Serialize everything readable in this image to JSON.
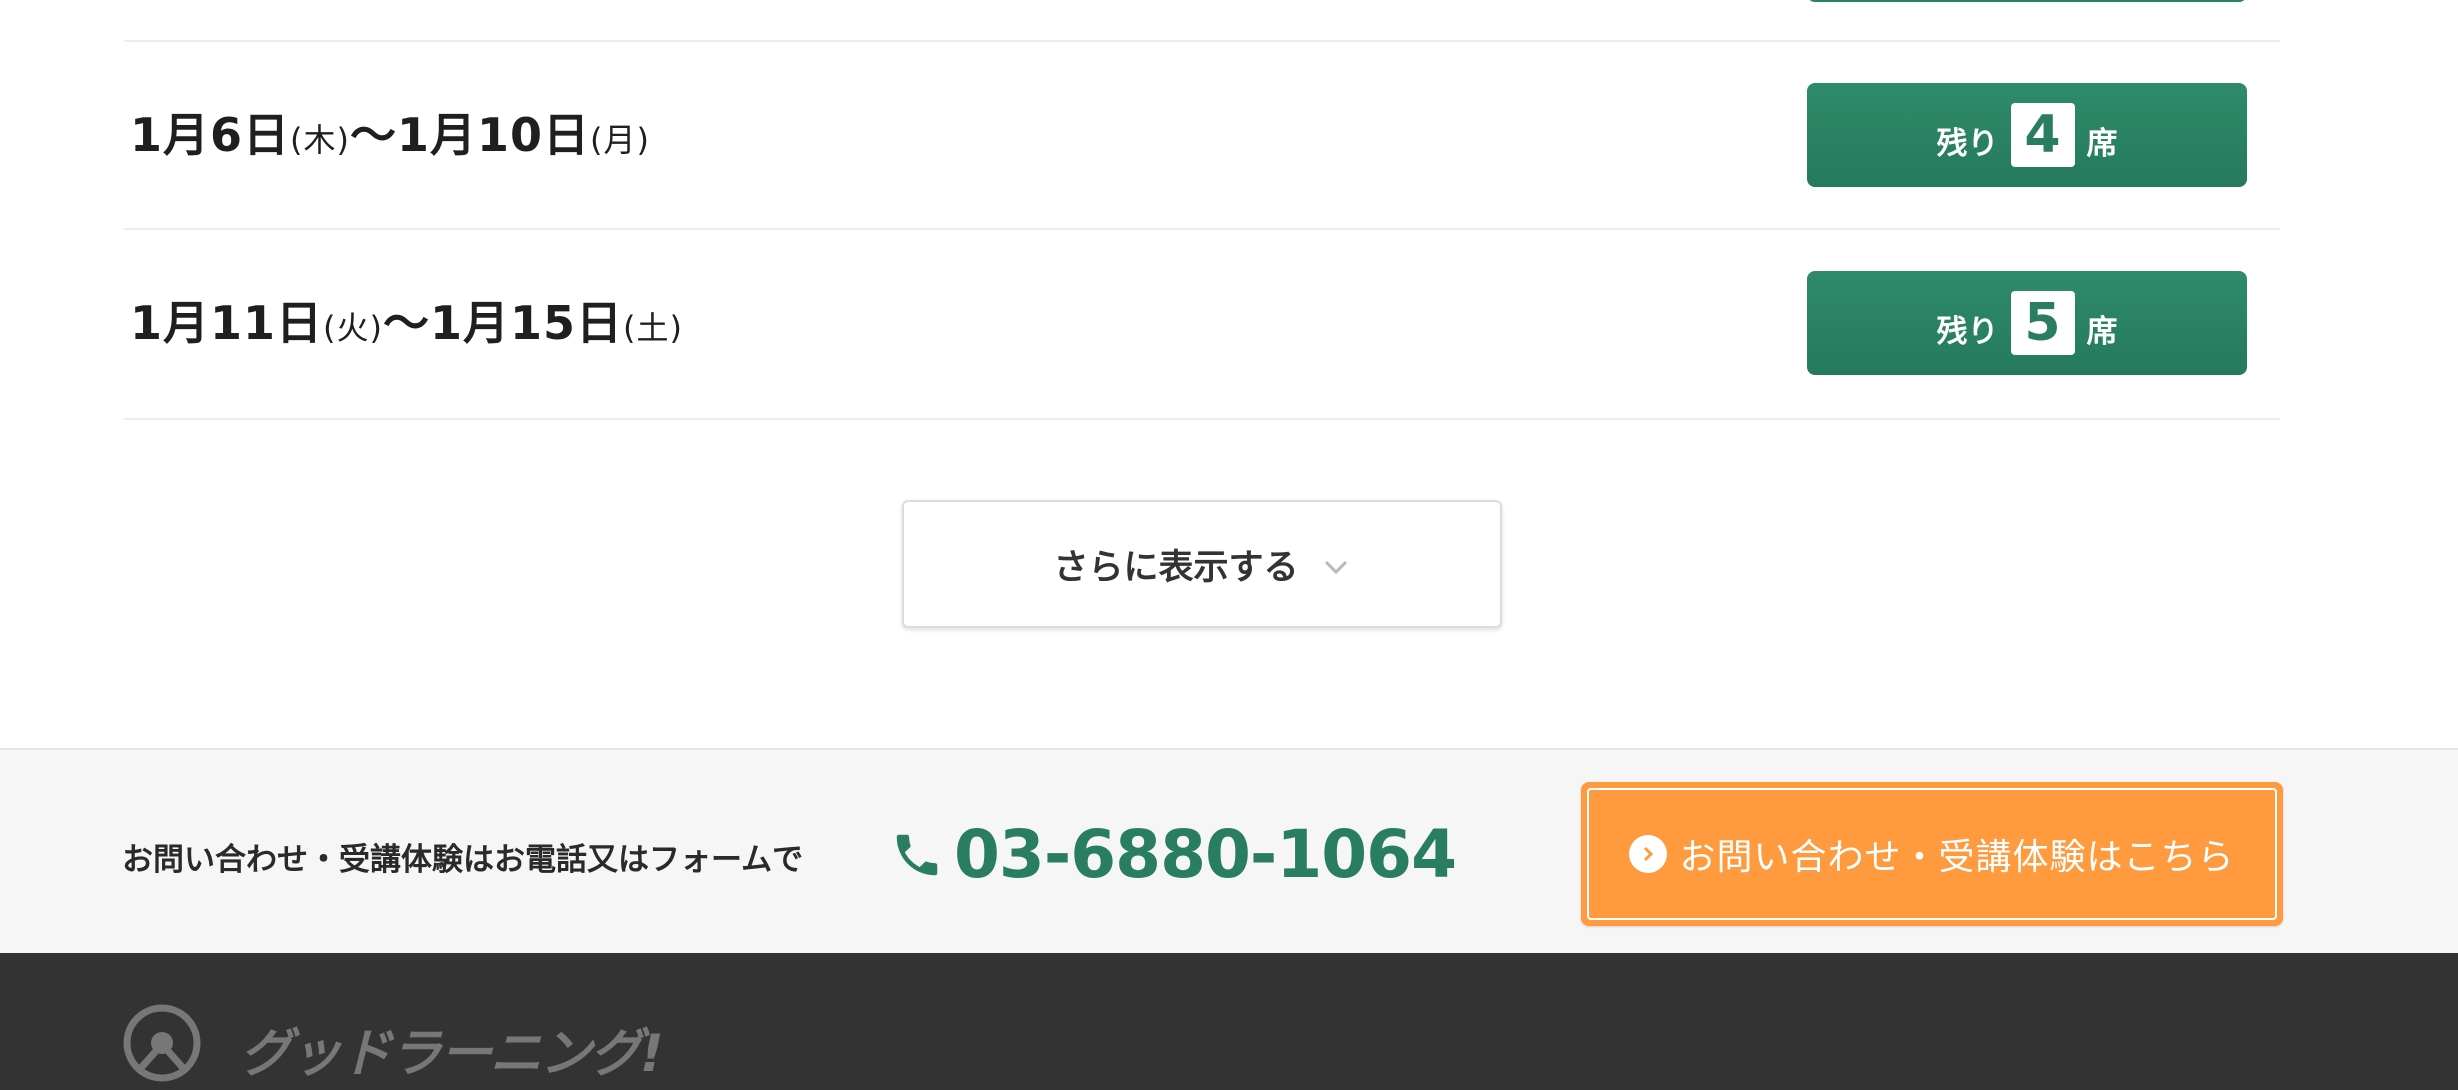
{
  "schedule": {
    "sessions": [
      {
        "start": "1月6日",
        "start_dow": "(木)",
        "sep": "〜",
        "end": "1月10日",
        "end_dow": "(月)",
        "seat_prefix": "残り",
        "seats_left": "4",
        "seat_suffix": "席"
      },
      {
        "start": "1月11日",
        "start_dow": "(火)",
        "sep": "〜",
        "end": "1月15日",
        "end_dow": "(土)",
        "seat_prefix": "残り",
        "seats_left": "5",
        "seat_suffix": "席"
      }
    ],
    "more_label": "さらに表示する"
  },
  "contact": {
    "text": "お問い合わせ・受講体験はお電話又はフォームで",
    "phone": "03-6880-1064",
    "cta_label": "お問い合わせ・受講体験はこちら"
  },
  "footer": {
    "logo_text": "グッドラーニング!"
  },
  "colors": {
    "accent_green": "#2a7e60",
    "cta_orange": "#ff9b3e",
    "footer_bg": "#333333"
  },
  "icons": {
    "more": "chevron-down-icon",
    "phone": "phone-icon",
    "cta": "arrow-right-circle-icon",
    "logo": "logo-icon"
  }
}
